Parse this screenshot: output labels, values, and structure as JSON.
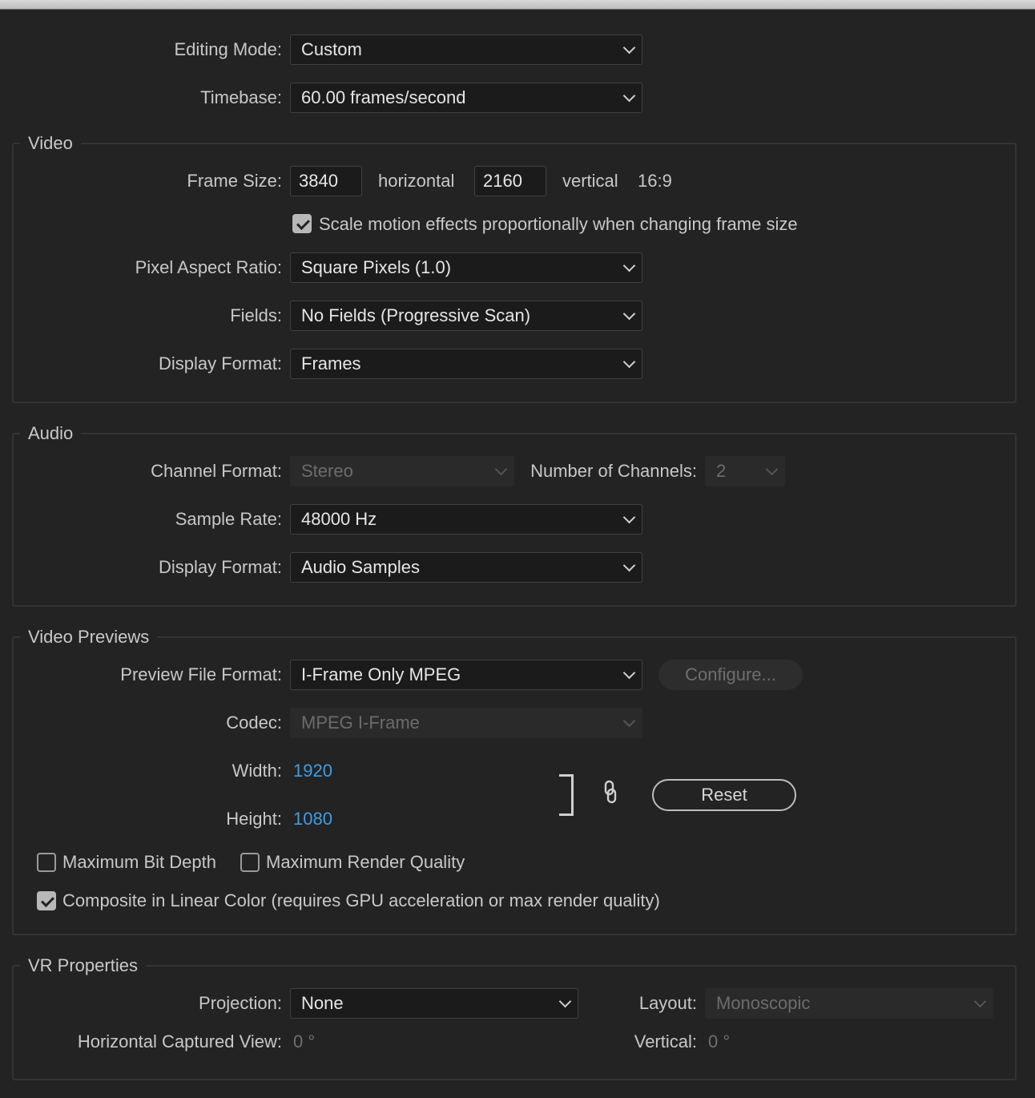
{
  "editing_mode": {
    "label": "Editing Mode:",
    "value": "Custom"
  },
  "timebase": {
    "label": "Timebase:",
    "value": "60.00  frames/second"
  },
  "video": {
    "legend": "Video",
    "frame_size_label": "Frame Size:",
    "width": "3840",
    "horizontal_label": "horizontal",
    "height": "2160",
    "vertical_label": "vertical",
    "aspect": "16:9",
    "scale_motion_label": "Scale motion effects proportionally when changing frame size",
    "scale_motion_checked": true,
    "pixel_aspect_label": "Pixel Aspect Ratio:",
    "pixel_aspect_value": "Square Pixels (1.0)",
    "fields_label": "Fields:",
    "fields_value": "No Fields (Progressive Scan)",
    "display_format_label": "Display Format:",
    "display_format_value": "Frames"
  },
  "audio": {
    "legend": "Audio",
    "channel_format_label": "Channel Format:",
    "channel_format_value": "Stereo",
    "num_channels_label": "Number of Channels:",
    "num_channels_value": "2",
    "sample_rate_label": "Sample Rate:",
    "sample_rate_value": "48000 Hz",
    "display_format_label": "Display Format:",
    "display_format_value": "Audio Samples"
  },
  "previews": {
    "legend": "Video Previews",
    "file_format_label": "Preview File Format:",
    "file_format_value": "I-Frame Only MPEG",
    "configure_label": "Configure...",
    "codec_label": "Codec:",
    "codec_value": "MPEG I-Frame",
    "width_label": "Width:",
    "width_value": "1920",
    "height_label": "Height:",
    "height_value": "1080",
    "reset_label": "Reset",
    "max_bit_depth_label": "Maximum Bit Depth",
    "max_bit_depth_checked": false,
    "max_render_label": "Maximum Render Quality",
    "max_render_checked": false,
    "linear_color_label": "Composite in Linear Color (requires GPU acceleration or max render quality)",
    "linear_color_checked": true
  },
  "vr": {
    "legend": "VR Properties",
    "projection_label": "Projection:",
    "projection_value": "None",
    "layout_label": "Layout:",
    "layout_value": "Monoscopic",
    "h_view_label": "Horizontal Captured View:",
    "h_view_value": "0 °",
    "vertical_label": "Vertical:",
    "vertical_value": "0 °"
  },
  "colors": {
    "background": "#232323",
    "field_bg": "#1b1b1b",
    "link_value": "#3d9ee8"
  },
  "icons": {
    "dropdown": "chevron-down-icon",
    "lock": "link-chain-icon",
    "checkbox": "checkmark-icon"
  }
}
